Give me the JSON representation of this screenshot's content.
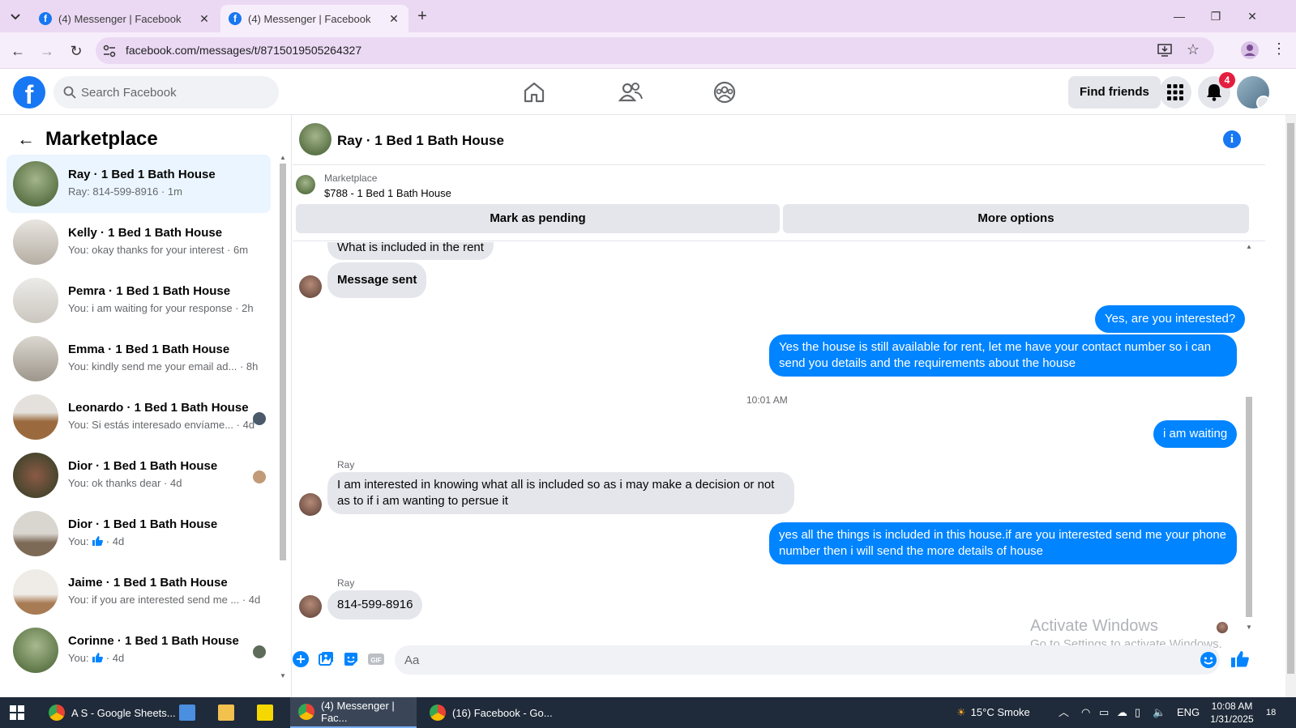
{
  "browser": {
    "tabs": [
      {
        "title": "(4) Messenger | Facebook",
        "active": false
      },
      {
        "title": "(4) Messenger | Facebook",
        "active": true
      }
    ],
    "url": "facebook.com/messages/t/8715019505264327"
  },
  "fb_header": {
    "logo": "f",
    "search_placeholder": "Search Facebook",
    "find_friends": "Find friends",
    "notif_count": "4"
  },
  "sidebar": {
    "title": "Marketplace",
    "conversations": [
      {
        "name": "Ray · 1 Bed 1 Bath House",
        "preview": "Ray: 814-599-8916 · 1m",
        "selected": true,
        "thumb": "#5c7a4a"
      },
      {
        "name": "Kelly · 1 Bed 1 Bath House",
        "preview": "You: okay thanks for your interest · 6m",
        "thumb": "#c8c4bd"
      },
      {
        "name": "Pemra · 1 Bed 1 Bath House",
        "preview": "You: i am waiting for your response · 2h",
        "thumb": "#d4d2cf"
      },
      {
        "name": "Emma · 1 Bed 1 Bath House",
        "preview": "You: kindly send me your email ad... · 8h",
        "thumb": "#b9b5ad"
      },
      {
        "name": "Leonardo · 1 Bed 1 Bath House",
        "preview": "You: Si estás interesado envíame... · 4d",
        "thumb": "#a07850"
      },
      {
        "name": "Dior · 1 Bed 1 Bath House",
        "preview": "You: ok thanks dear · 4d",
        "thumb": "#6b5a48"
      },
      {
        "name": "Dior · 1 Bed 1 Bath House",
        "preview_prefix": "You:",
        "preview_suffix": " · 4d",
        "thumb": "#9b8b78"
      },
      {
        "name": "Jaime · 1 Bed 1 Bath House",
        "preview": "You: if you are interested send me ... · 4d",
        "thumb": "#c9bfb2"
      },
      {
        "name": "Corinne · 1 Bed 1 Bath House",
        "preview_prefix": "You:",
        "preview_suffix": " · 4d",
        "thumb": "#6e8a5a"
      }
    ]
  },
  "chat": {
    "title": "Ray · 1 Bed 1 Bath House",
    "marketplace_label": "Marketplace",
    "listing": "$788 - 1 Bed 1 Bath House",
    "mark_pending": "Mark as pending",
    "more_options": "More options",
    "messages": {
      "m1": "What is included in the rent",
      "m2": "Message sent",
      "m3": "Yes, are you interested?",
      "m4": "Yes the house is still available for rent, let me have your contact number so i can send you details and the requirements about the house",
      "time": "10:01 AM",
      "m5": "i am waiting",
      "sender1": "Ray",
      "m6": "I am interested in knowing what all is included so as i may make a decision or not as to if i am wanting to persue it",
      "m7": "yes all the things is included in this house.if are you interested send me your phone number then i will send the more details of house",
      "sender2": "Ray",
      "m8": "814-599-8916"
    },
    "input_placeholder": "Aa",
    "watermark_title": "Activate Windows",
    "watermark_sub": "Go to Settings to activate Windows."
  },
  "taskbar": {
    "items": [
      {
        "label": "A S - Google Sheets...",
        "active": false
      },
      {
        "label": "(4) Messenger | Fac...",
        "active": true
      },
      {
        "label": "(16) Facebook - Go...",
        "active": false
      }
    ],
    "weather": "15°C  Smoke",
    "lang": "ENG",
    "time": "10:08 AM",
    "date": "1/31/2025",
    "notif": "18"
  }
}
